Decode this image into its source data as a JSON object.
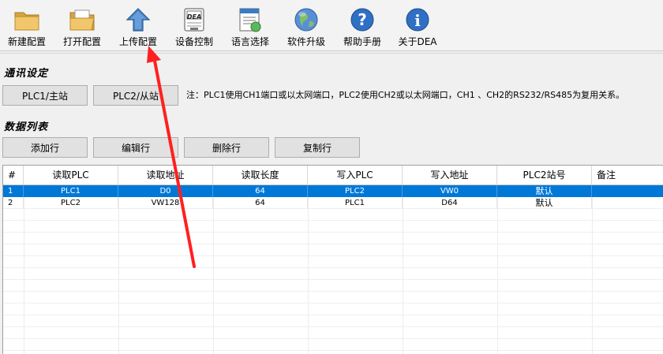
{
  "toolbar": {
    "items": [
      {
        "label": "新建配置",
        "icon": "new-folder-icon"
      },
      {
        "label": "打开配置",
        "icon": "open-folder-icon"
      },
      {
        "label": "上传配置",
        "icon": "upload-arrow-icon"
      },
      {
        "label": "设备控制",
        "icon": "device-dea-icon"
      },
      {
        "label": "语言选择",
        "icon": "language-doc-icon"
      },
      {
        "label": "软件升级",
        "icon": "globe-icon"
      },
      {
        "label": "帮助手册",
        "icon": "help-icon"
      },
      {
        "label": "关于DEA",
        "icon": "info-icon"
      }
    ],
    "device_icon_text": "DEA"
  },
  "comm": {
    "title": "通讯设定",
    "plc1_button": "PLC1/主站",
    "plc2_button": "PLC2/从站",
    "note": "注：PLC1使用CH1端口或以太网端口，PLC2使用CH2或以太网端口，CH1 、CH2的RS232/RS485为复用关系。"
  },
  "datalist": {
    "title": "数据列表",
    "add_button": "添加行",
    "edit_button": "编辑行",
    "delete_button": "删除行",
    "copy_button": "复制行"
  },
  "grid": {
    "columns": [
      "#",
      "读取PLC",
      "读取地址",
      "读取长度",
      "写入PLC",
      "写入地址",
      "PLC2站号",
      "备注"
    ],
    "rows": [
      [
        "1",
        "PLC1",
        "D0",
        "64",
        "PLC2",
        "VW0",
        "默认",
        ""
      ],
      [
        "2",
        "PLC2",
        "VW128",
        "64",
        "PLC1",
        "D64",
        "默认",
        ""
      ]
    ],
    "selected_row": 0
  },
  "colors": {
    "selection": "#0078d7",
    "annotation_arrow": "#ff2020"
  }
}
